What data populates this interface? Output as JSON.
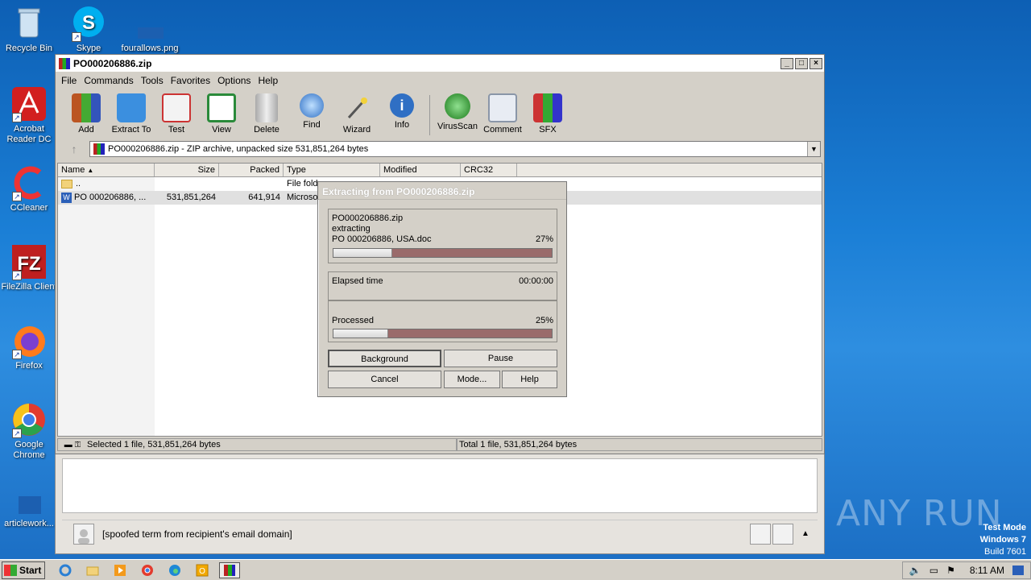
{
  "desktop": {
    "icons": [
      {
        "label": "Recycle Bin"
      },
      {
        "label": "Skype"
      },
      {
        "label": "fourallows.png"
      },
      {
        "label": "Acrobat Reader DC"
      },
      {
        "label": "CCleaner"
      },
      {
        "label": "FileZilla Client"
      },
      {
        "label": "Firefox"
      },
      {
        "label": "Google Chrome"
      },
      {
        "label": "articlework..."
      }
    ],
    "watermark": "ANY RUN",
    "testmode": {
      "line1": "Test Mode",
      "line2": "Windows 7",
      "line3": "Build 7601"
    }
  },
  "window": {
    "title": "PO000206886.zip",
    "menu": [
      "File",
      "Commands",
      "Tools",
      "Favorites",
      "Options",
      "Help"
    ],
    "toolbar": [
      "Add",
      "Extract To",
      "Test",
      "View",
      "Delete",
      "Find",
      "Wizard",
      "Info",
      "VirusScan",
      "Comment",
      "SFX"
    ],
    "address": "PO000206886.zip - ZIP archive, unpacked size 531,851,264 bytes",
    "columns": [
      "Name",
      "Size",
      "Packed",
      "Type",
      "Modified",
      "CRC32"
    ],
    "rows": [
      {
        "name": "..",
        "size": "",
        "packed": "",
        "type": "File fold"
      },
      {
        "name": "PO 000206886, ...",
        "size": "531,851,264",
        "packed": "641,914",
        "type": "Microso"
      }
    ],
    "status_left": "Selected 1 file, 531,851,264 bytes",
    "status_right": "Total 1 file, 531,851,264 bytes"
  },
  "dialog": {
    "title": "Extracting from PO000206886.zip",
    "archive": "PO000206886.zip",
    "action": "extracting",
    "file": "PO 000206886, USA.doc",
    "file_percent": "27%",
    "file_progress": 0.27,
    "elapsed_label": "Elapsed time",
    "elapsed_value": "00:00:00",
    "processed_label": "Processed",
    "processed_percent": "25%",
    "processed_progress": 0.25,
    "buttons": {
      "background": "Background",
      "pause": "Pause",
      "cancel": "Cancel",
      "mode": "Mode...",
      "help": "Help"
    }
  },
  "email": {
    "footer_text": "[spoofed term from recipient's email domain]"
  },
  "taskbar": {
    "start": "Start",
    "clock": "8:11 AM"
  }
}
